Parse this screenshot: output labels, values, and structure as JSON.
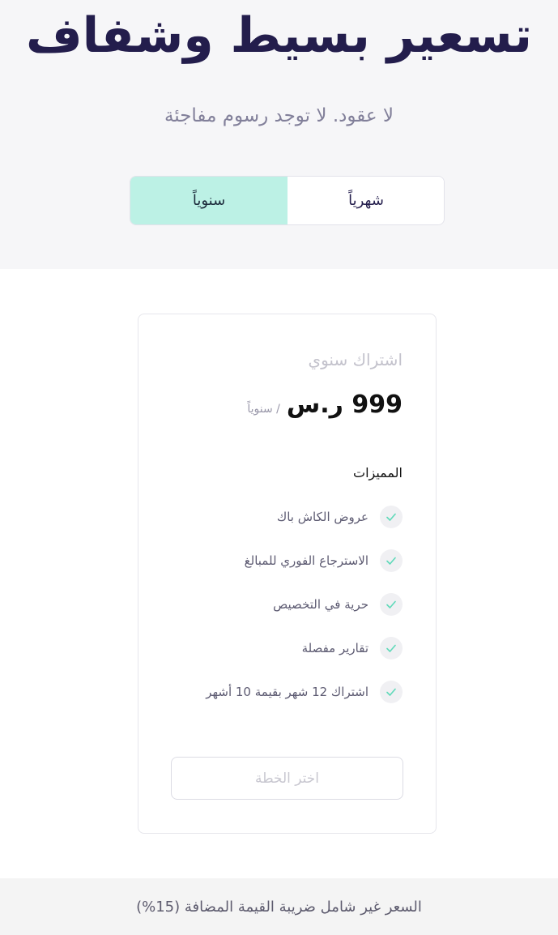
{
  "hero": {
    "title": "تسعير بسيط وشفاف",
    "subtitle": "لا عقود. لا توجد رسوم مفاجئة"
  },
  "billing_toggle": {
    "monthly_label": "شهرياً",
    "yearly_label": "سنوياً",
    "selected": "yearly",
    "selected_color": "#bcf1e5"
  },
  "plan": {
    "name": "اشتراك سنوي",
    "price": "999 ر.س",
    "period": "/ سنوياً",
    "features_title": "المميزات",
    "features": [
      "عروض الكاش باك",
      "الاسترجاع الفوري للمبالغ",
      "حرية في التخصيص",
      "تقارير مفصلة",
      "اشتراك 12 شهر بقيمة 10 أشهر"
    ],
    "check_icon": "check-icon",
    "check_color": "#5fd9b9",
    "choose_button": "اختر الخطة"
  },
  "footer": {
    "note": "السعر غير شامل ضريبة القيمة المضافة (15%)"
  }
}
